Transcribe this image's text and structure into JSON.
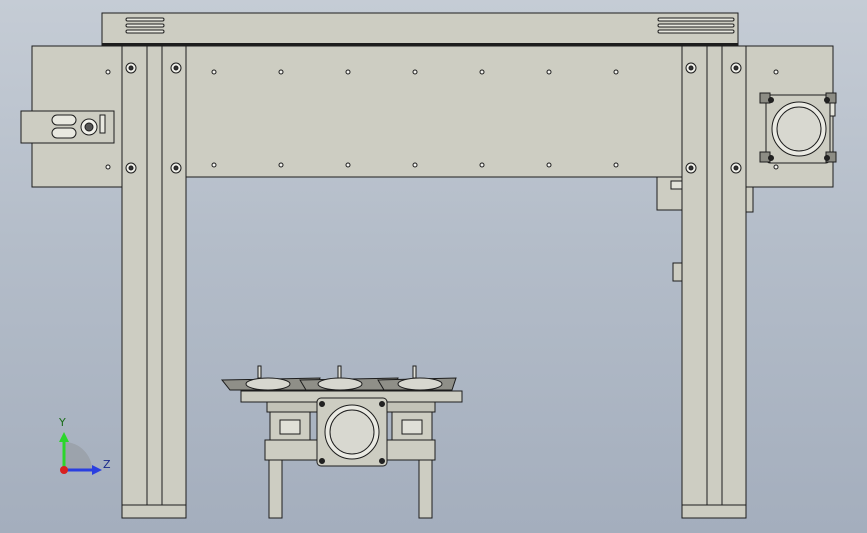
{
  "viewport": {
    "background_top": "#c5ccd5",
    "background_bottom": "#a4aebd",
    "part_fill": "#cdcdc2",
    "part_fill_dark": "#b9b9ad",
    "edge_color": "#1d1d1d"
  },
  "triad": {
    "y_label": "Y",
    "z_label": "Z",
    "y_color": "#2bd62b",
    "z_color": "#2a3fe0",
    "x_color": "#d82020",
    "plane_color": "#9aa0a8"
  }
}
